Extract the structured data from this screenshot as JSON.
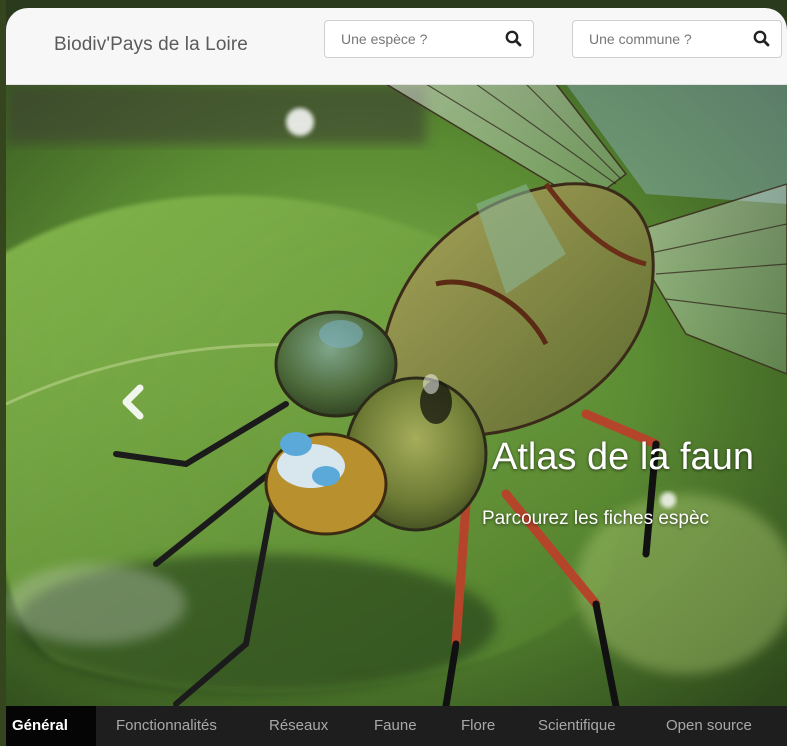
{
  "header": {
    "brand": "Biodiv'Pays de la Loire",
    "species_search": {
      "placeholder": "Une espèce ?",
      "button_icon": "search-icon"
    },
    "commune_search": {
      "placeholder": "Une commune ?",
      "button_icon": "search-icon"
    }
  },
  "hero": {
    "title": "Atlas de la faun",
    "subtitle": "Parcourez les fiches espèc",
    "prev_icon": "chevron-left-icon"
  },
  "tabs": [
    {
      "label": "Général",
      "active": true
    },
    {
      "label": "Fonctionnalités",
      "active": false
    },
    {
      "label": "Réseaux",
      "active": false
    },
    {
      "label": "Faune",
      "active": false
    },
    {
      "label": "Flore",
      "active": false
    },
    {
      "label": "Scientifique",
      "active": false
    },
    {
      "label": "Open source",
      "active": false
    }
  ],
  "colors": {
    "header_bg": "#f7f7f7",
    "tabs_bg": "#1e1e1e",
    "active_tab_bg": "#050505",
    "caption_text": "#ffffff"
  }
}
